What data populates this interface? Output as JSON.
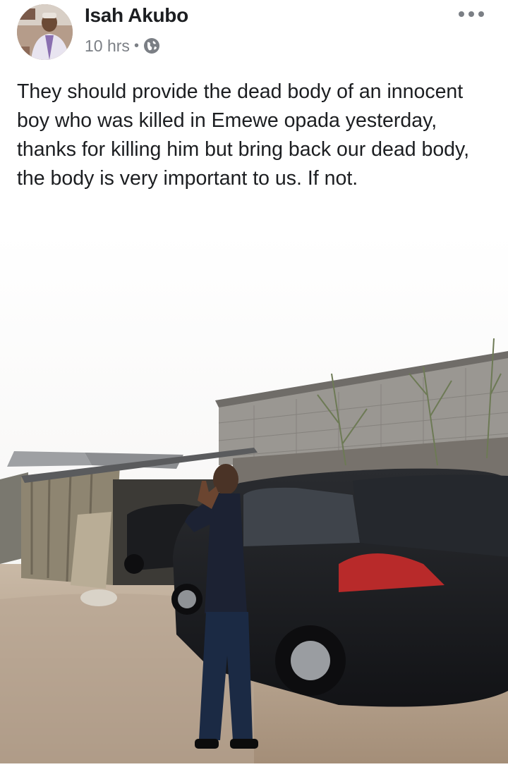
{
  "post": {
    "author": "Isah Akubo",
    "timestamp": "10 hrs",
    "separator": "•",
    "privacy_icon": "globe-icon",
    "more_icon": "more-options-icon",
    "text": "They should provide the dead body of an innocent boy who was killed in Emewe opada yesterday, thanks for killing him but bring back our dead body, the body is very important to us. If not.",
    "photo_icon": "post-photo"
  },
  "colors": {
    "text": "#1c1e21",
    "secondary_text": "#7b7f85",
    "background": "#ffffff"
  }
}
